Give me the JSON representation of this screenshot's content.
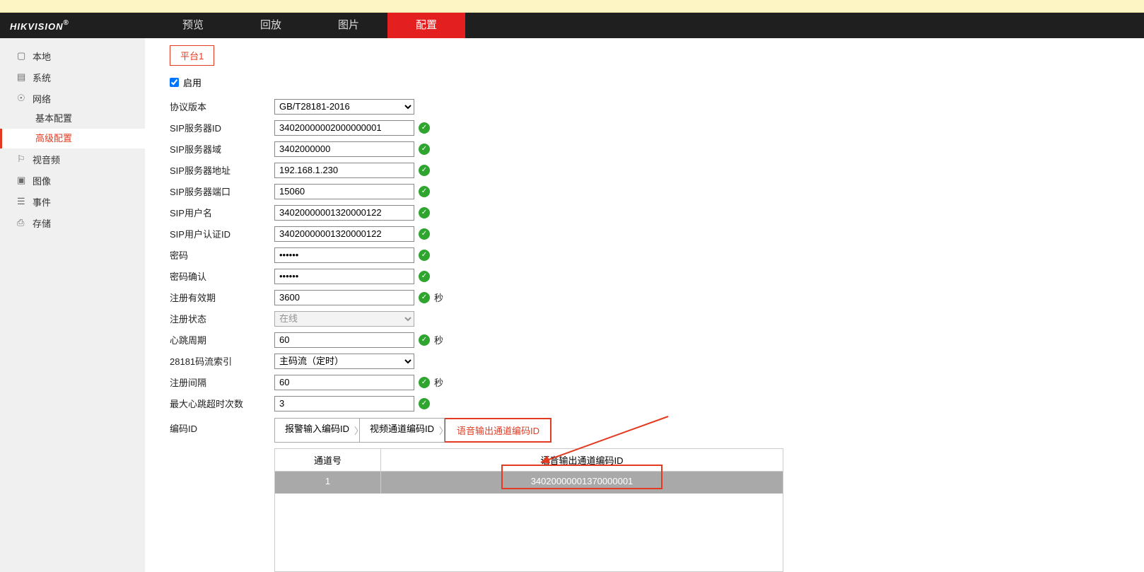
{
  "brand": "HIKVISION",
  "brand_suffix": "®",
  "nav": {
    "preview": "预览",
    "playback": "回放",
    "image": "图片",
    "config": "配置"
  },
  "sidebar": {
    "local": "本地",
    "system": "系统",
    "network": "网络",
    "basic": "基本配置",
    "advanced": "高级配置",
    "av": "视音频",
    "img": "图像",
    "event": "事件",
    "storage": "存储"
  },
  "tab": "平台1",
  "enable_label": "启用",
  "fields": {
    "protocol": {
      "label": "协议版本",
      "value": "GB/T28181-2016"
    },
    "sip_id": {
      "label": "SIP服务器ID",
      "value": "34020000002000000001"
    },
    "sip_domain": {
      "label": "SIP服务器域",
      "value": "3402000000"
    },
    "sip_addr": {
      "label": "SIP服务器地址",
      "value": "192.168.1.230"
    },
    "sip_port": {
      "label": "SIP服务器端口",
      "value": "15060"
    },
    "sip_user": {
      "label": "SIP用户名",
      "value": "34020000001320000122"
    },
    "sip_auth": {
      "label": "SIP用户认证ID",
      "value": "34020000001320000122"
    },
    "pwd": {
      "label": "密码",
      "value": "••••••"
    },
    "pwd2": {
      "label": "密码确认",
      "value": "••••••"
    },
    "reg_expire": {
      "label": "注册有效期",
      "value": "3600",
      "unit": "秒"
    },
    "reg_status": {
      "label": "注册状态",
      "value": "在线"
    },
    "heartbeat": {
      "label": "心跳周期",
      "value": "60",
      "unit": "秒"
    },
    "stream_idx": {
      "label": "28181码流索引",
      "value": "主码流（定时）"
    },
    "reg_interval": {
      "label": "注册间隔",
      "value": "60",
      "unit": "秒"
    },
    "max_hb": {
      "label": "最大心跳超时次数",
      "value": "3"
    },
    "encode_id": {
      "label": "编码ID"
    }
  },
  "encode_tabs": {
    "alarm": "报警输入编码ID",
    "video": "视频通道编码ID",
    "audio": "语音输出通道编码ID"
  },
  "table": {
    "col1": "通道号",
    "col2": "语音输出通道编码ID",
    "row": {
      "ch": "1",
      "val": "34020000001370000001"
    }
  }
}
